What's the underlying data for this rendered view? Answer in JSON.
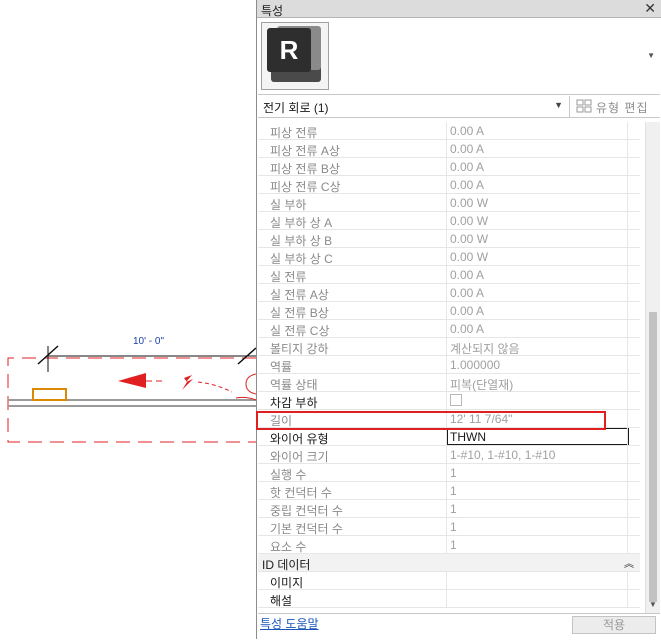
{
  "canvas": {
    "dimension_label": "10' - 0\"",
    "accent": "#e02020",
    "dimension_color": "#1a3fa8"
  },
  "panel": {
    "title": "특성",
    "close_icon": "close-icon",
    "type_thumbnail_letter": "R",
    "instance_selector": "전기 회로 (1)",
    "edit_type_label": "유형 편집",
    "help_link": "특성 도움말",
    "apply_label": "적용"
  },
  "properties": [
    {
      "name": "피상 전류",
      "value": "0.00 A"
    },
    {
      "name": "피상 전류 A상",
      "value": "0.00 A"
    },
    {
      "name": "피상 전류 B상",
      "value": "0.00 A"
    },
    {
      "name": "피상 전류 C상",
      "value": "0.00 A"
    },
    {
      "name": "실 부하",
      "value": "0.00 W"
    },
    {
      "name": "실 부하 상 A",
      "value": "0.00 W"
    },
    {
      "name": "실 부하 상 B",
      "value": "0.00 W"
    },
    {
      "name": "실 부하 상 C",
      "value": "0.00 W"
    },
    {
      "name": "실 전류",
      "value": "0.00 A"
    },
    {
      "name": "실 전류 A상",
      "value": "0.00 A"
    },
    {
      "name": "실 전류 B상",
      "value": "0.00 A"
    },
    {
      "name": "실 전류 C상",
      "value": "0.00 A"
    },
    {
      "name": "볼티지 강하",
      "value": "계산되지 않음"
    },
    {
      "name": "역률",
      "value": "1.000000"
    },
    {
      "name": "역률 상태",
      "value": "피복(단열재)"
    },
    {
      "name": "차감 부하",
      "value": "",
      "checkbox": true,
      "editable": true
    },
    {
      "name": "길이",
      "value": "12'  11 7/64\"",
      "highlight": true
    },
    {
      "name": "와이어 유형",
      "value": "THWN",
      "editable": true,
      "input": true
    },
    {
      "name": "와이어 크기",
      "value": "1-#10, 1-#10, 1-#10"
    },
    {
      "name": "실행 수",
      "value": "1"
    },
    {
      "name": "핫 컨덕터 수",
      "value": "1"
    },
    {
      "name": "중립 컨덕터 수",
      "value": "1"
    },
    {
      "name": "기본 컨덕터 수",
      "value": "1"
    },
    {
      "name": "요소 수",
      "value": "1"
    },
    {
      "name": "ID 데이터",
      "section": true
    },
    {
      "name": "이미지",
      "value": "",
      "editable": true
    },
    {
      "name": "해설",
      "value": "",
      "editable": true
    }
  ]
}
